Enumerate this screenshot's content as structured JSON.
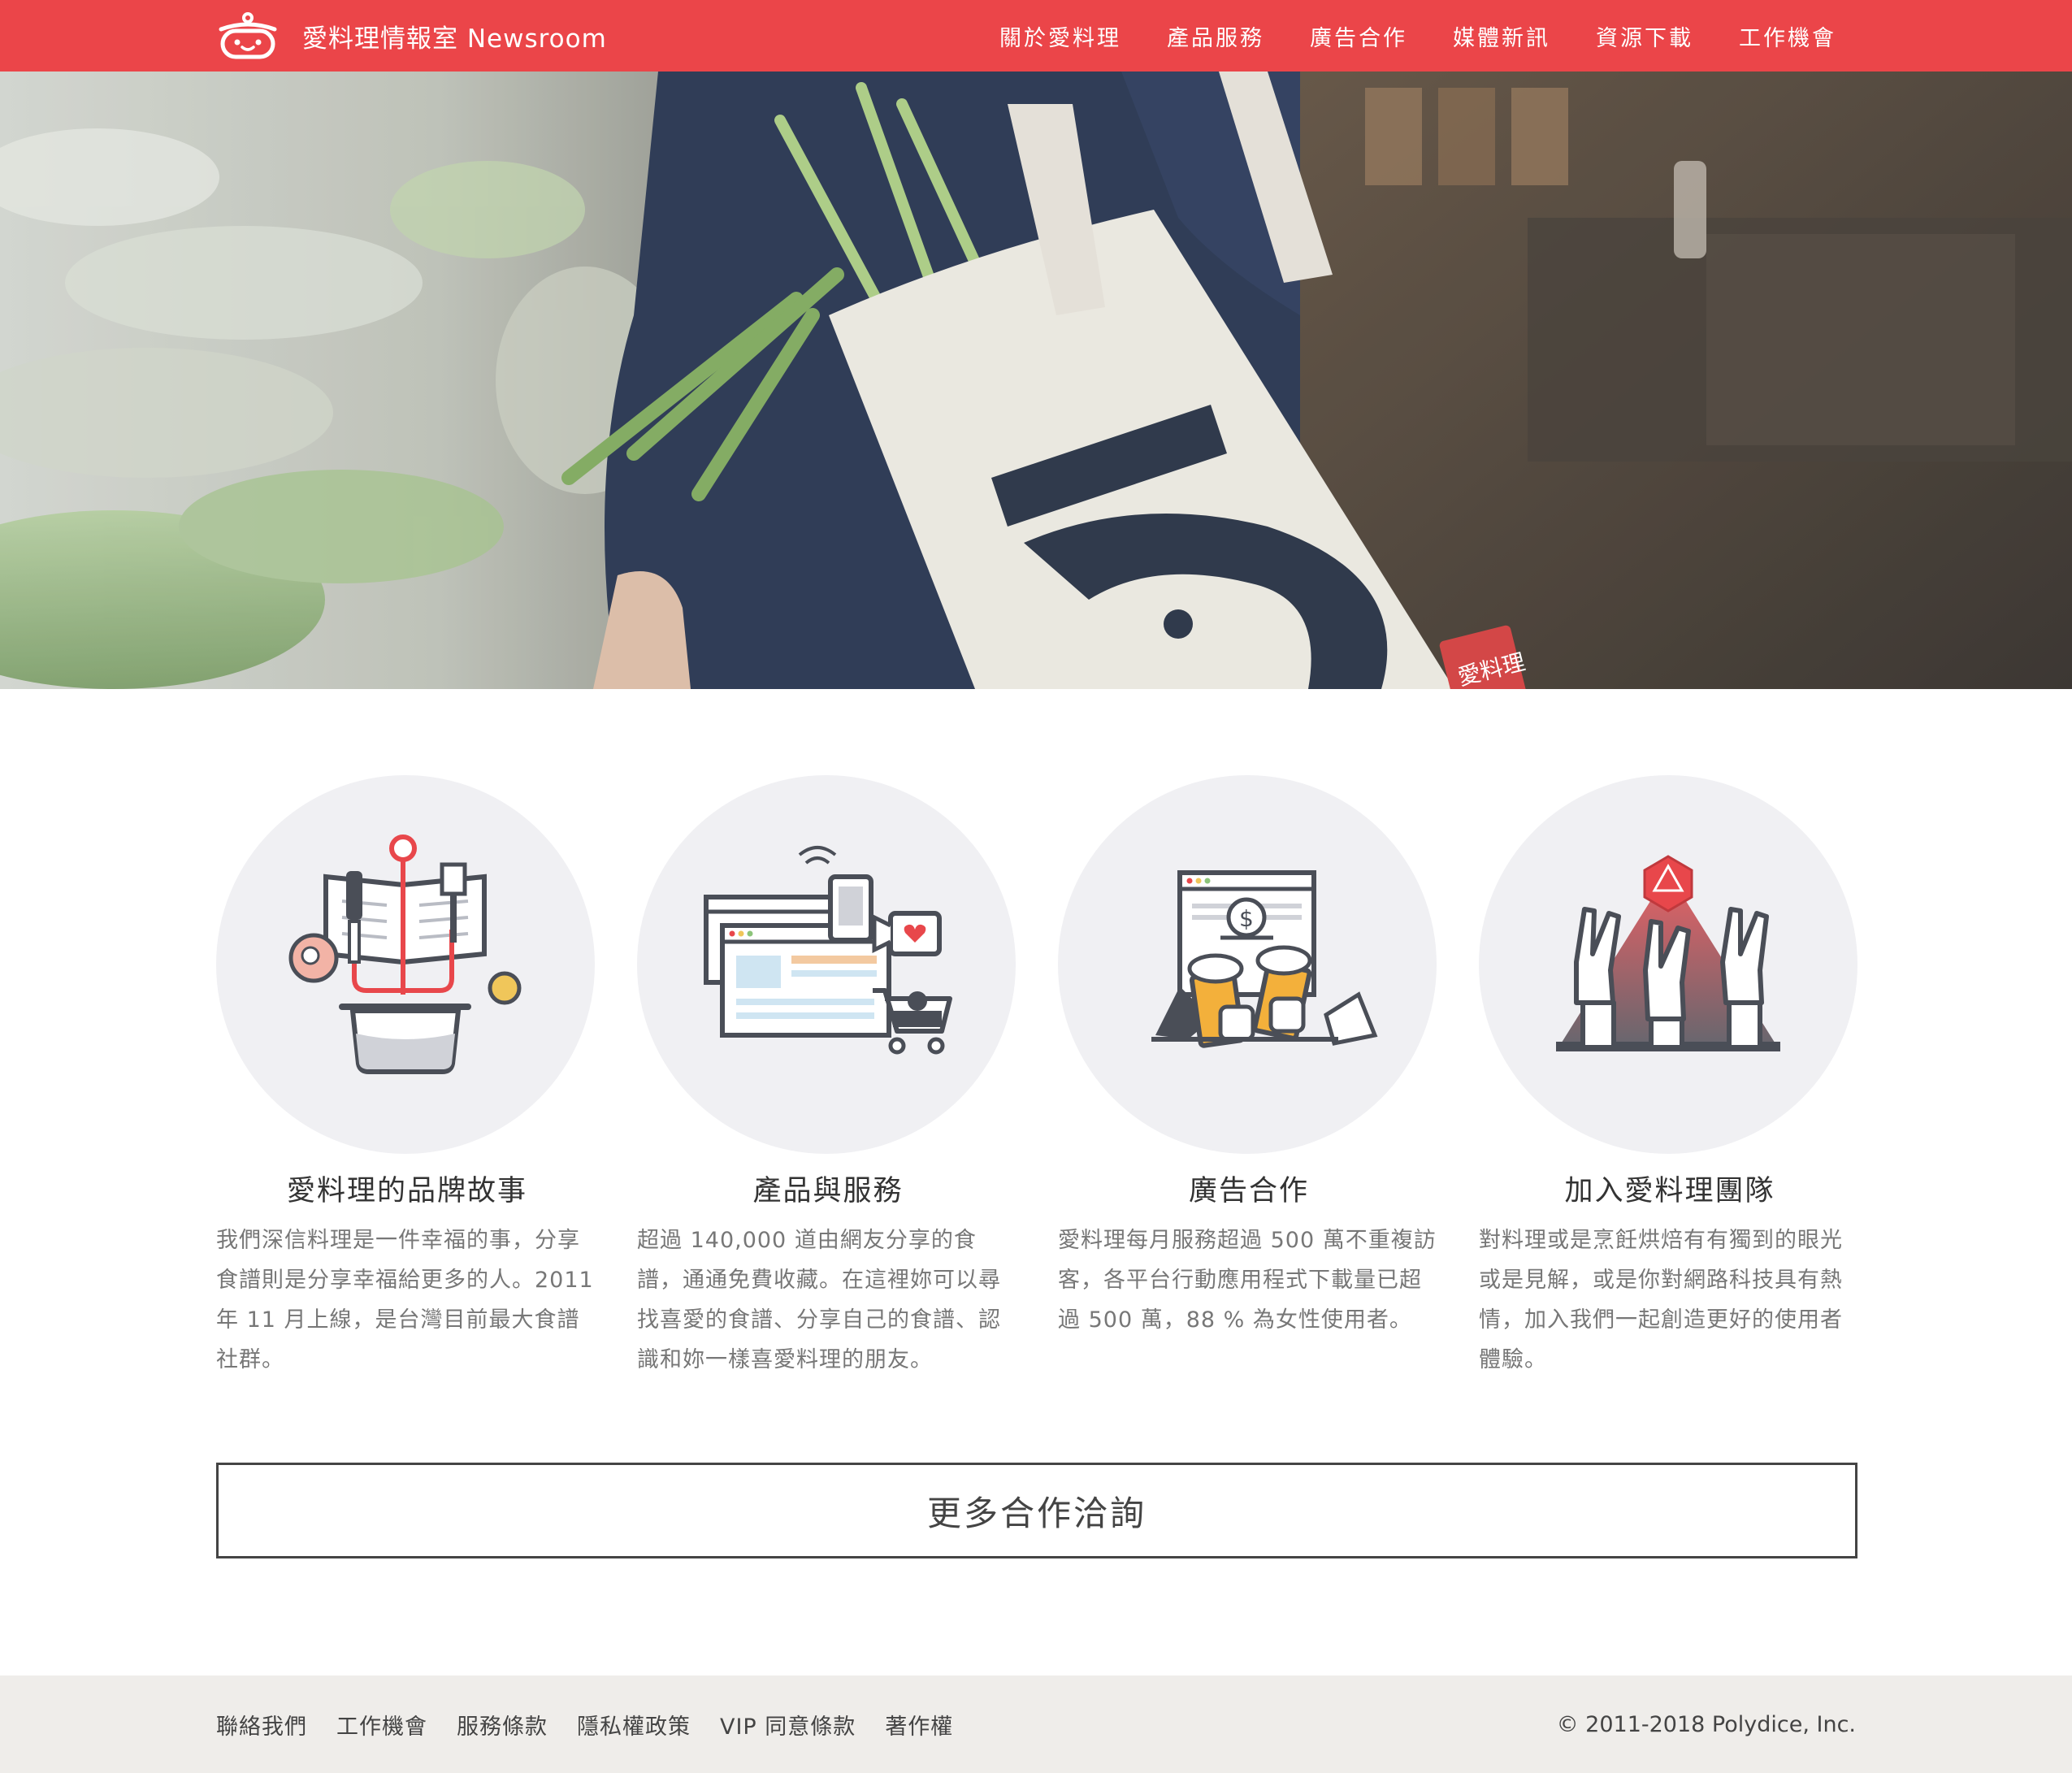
{
  "header": {
    "brand_title": "愛料理情報室 Newsroom",
    "logo_icon": "pot-face-logo-icon",
    "accent_color": "#eb4549",
    "nav": [
      {
        "label": "關於愛料理"
      },
      {
        "label": "產品服務"
      },
      {
        "label": "廣告合作"
      },
      {
        "label": "媒體新訊"
      },
      {
        "label": "資源下載"
      },
      {
        "label": "工作機會"
      }
    ]
  },
  "hero": {
    "bag_stamp": "愛料理"
  },
  "features": [
    {
      "icon": "recipe-book-pot-icon",
      "title": "愛料理的品牌故事",
      "desc": "我們深信料理是一件幸福的事，分享食譜則是分享幸福給更多的人。2011 年 11 月上線，是台灣目前最大食譜社群。"
    },
    {
      "icon": "devices-shopping-icon",
      "title": "產品與服務",
      "desc": "超過 140,000 道由網友分享的食譜，通通免費收藏。在這裡妳可以尋找喜愛的食譜、分享自己的食譜、認識和妳一樣喜愛料理的朋友。"
    },
    {
      "icon": "beer-toast-icon",
      "title": "廣告合作",
      "desc": "愛料理每月服務超過 500 萬不重複訪客，各平台行動應用程式下載量已超過 500 萬，88 % 為女性使用者。"
    },
    {
      "icon": "rock-hands-dice-icon",
      "title": "加入愛料理團隊",
      "desc": "對料理或是烹飪烘焙有有獨到的眼光或是見解，或是你對網路科技具有熱情，加入我們一起創造更好的使用者體驗。"
    }
  ],
  "cta": {
    "label": "更多合作洽詢"
  },
  "footer": {
    "links": [
      {
        "label": "聯絡我們"
      },
      {
        "label": "工作機會"
      },
      {
        "label": "服務條款"
      },
      {
        "label": "隱私權政策"
      },
      {
        "label": "VIP 同意條款"
      },
      {
        "label": "著作權"
      }
    ],
    "copyright": "© 2011-2018 Polydice, Inc."
  }
}
